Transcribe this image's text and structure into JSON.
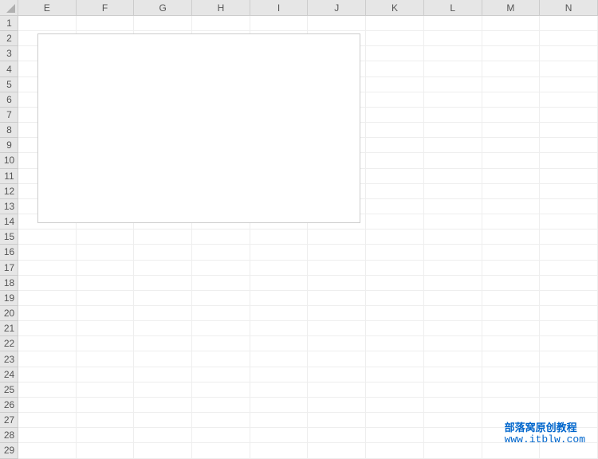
{
  "columns": [
    "E",
    "F",
    "G",
    "H",
    "I",
    "J",
    "K",
    "L",
    "M",
    "N"
  ],
  "rows": [
    "1",
    "2",
    "3",
    "4",
    "5",
    "6",
    "7",
    "8",
    "9",
    "10",
    "11",
    "12",
    "13",
    "14",
    "15",
    "16",
    "17",
    "18",
    "19",
    "20",
    "21",
    "22",
    "23",
    "24",
    "25",
    "26",
    "27",
    "28",
    "29"
  ],
  "watermark": {
    "title": "部落窝原创教程",
    "url": "www.itblw.com"
  },
  "corner_icon": "select-all-triangle",
  "colors": {
    "header_bg": "#e6e6e6",
    "header_border": "#cccccc",
    "grid_border": "#eeeeee",
    "link_color": "#0066cc"
  }
}
